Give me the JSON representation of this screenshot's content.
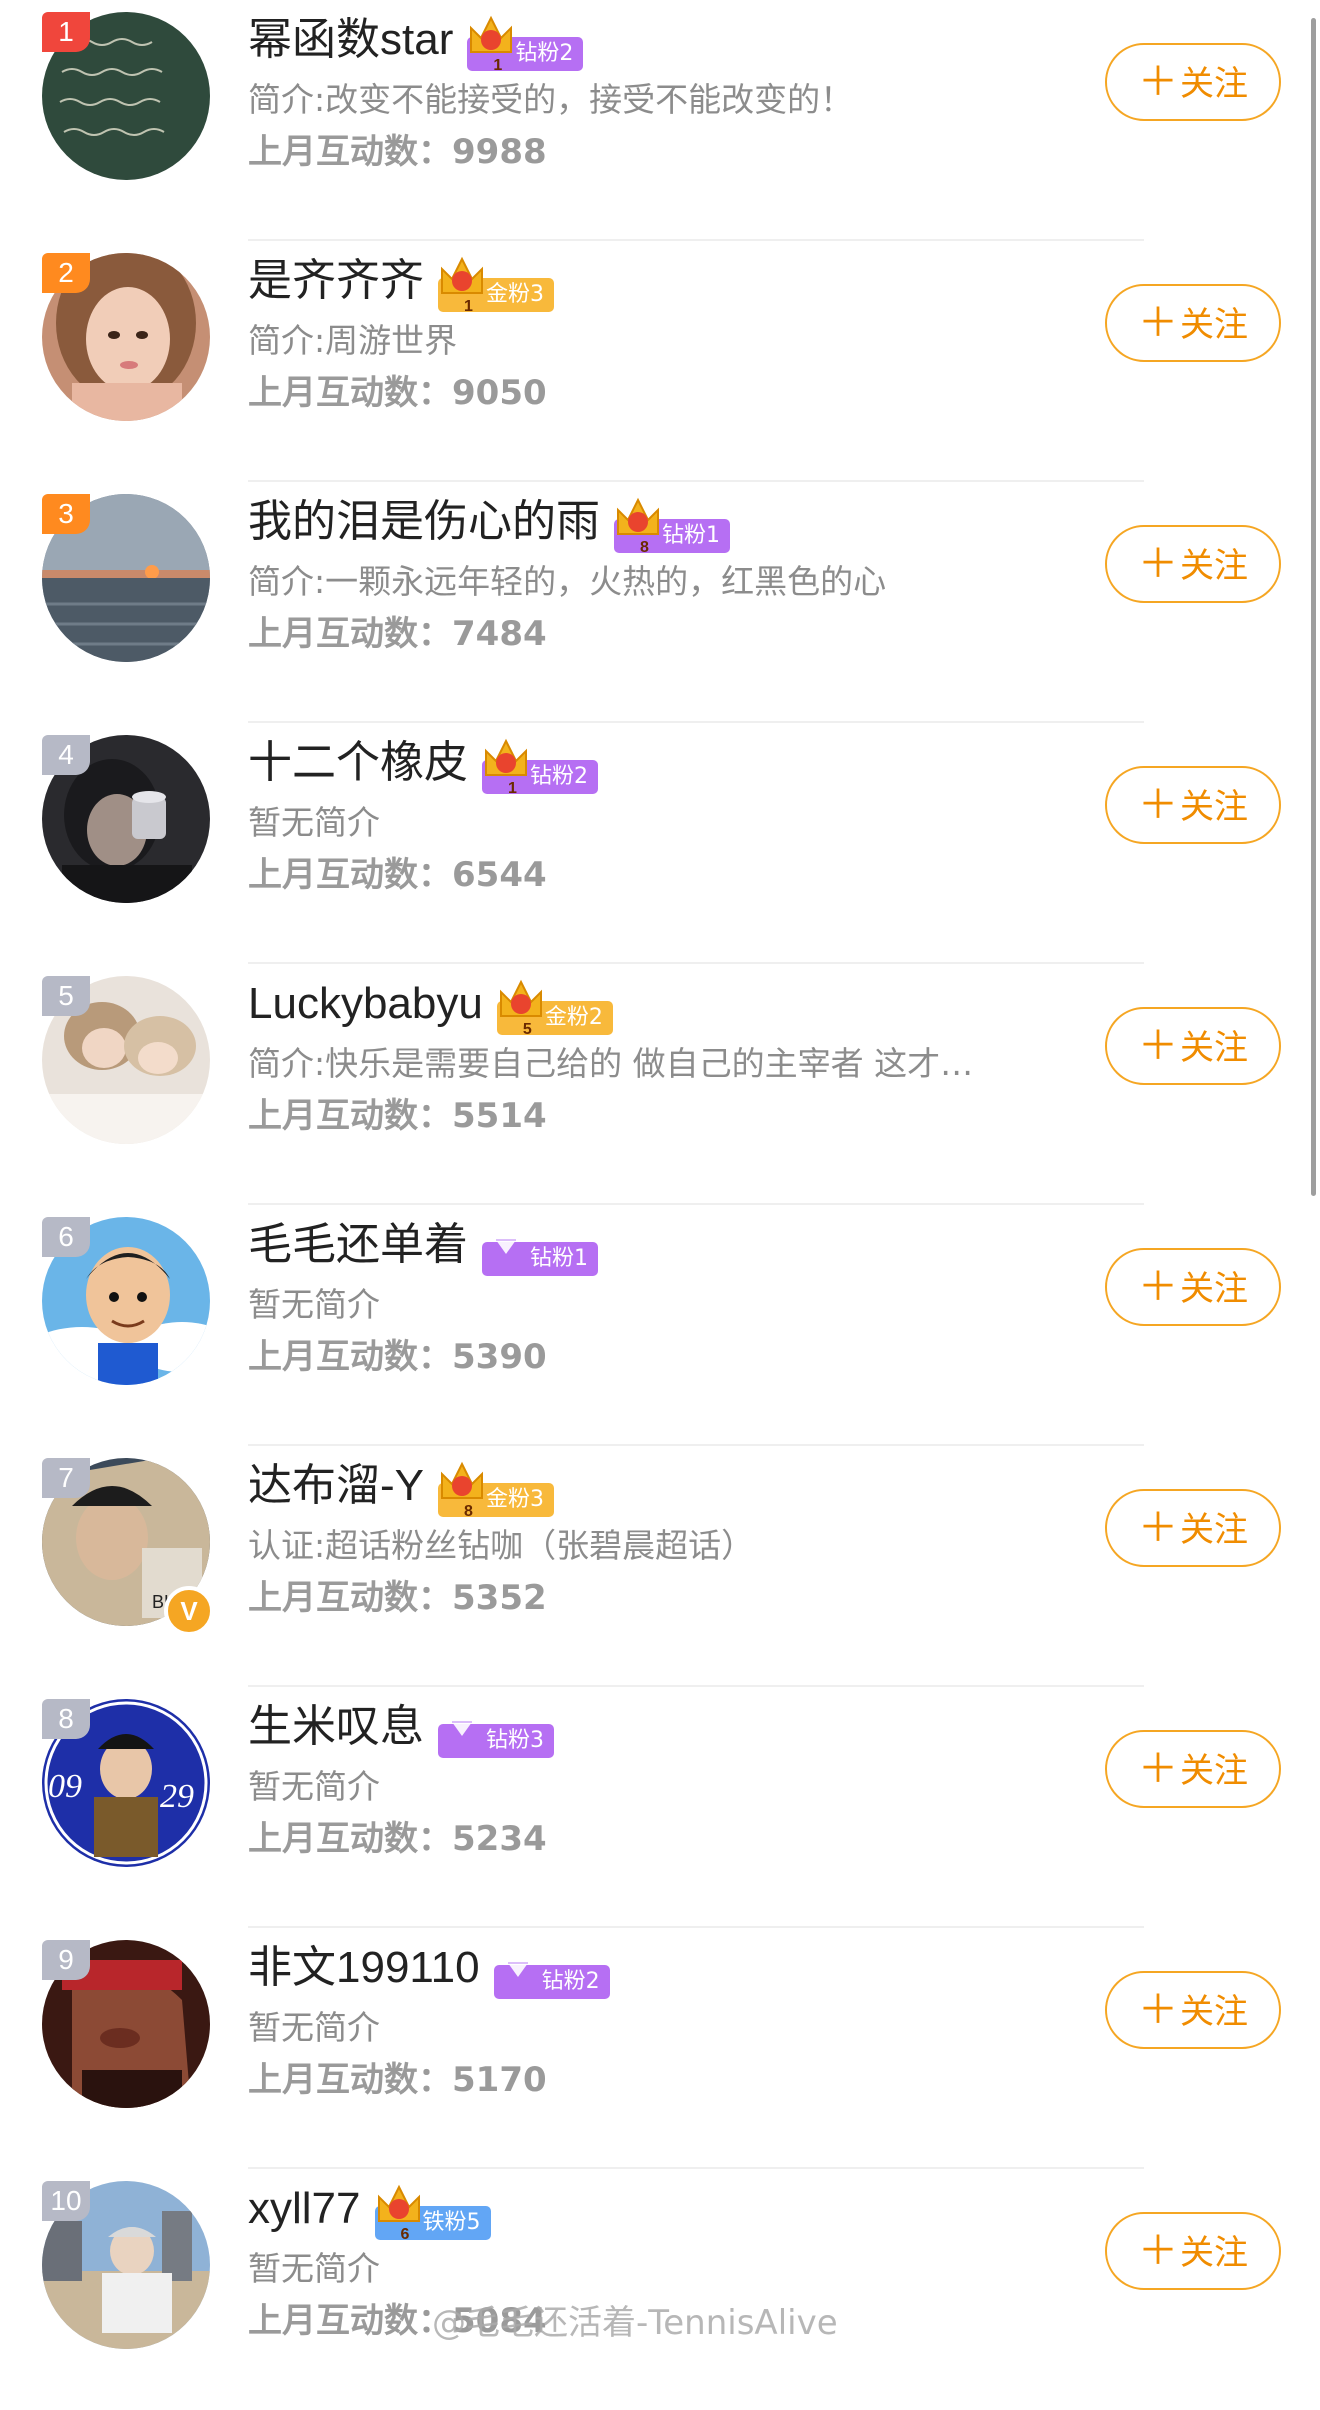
{
  "colors": {
    "follow_accent": "#f5a623",
    "rank_red": "#f0463c",
    "rank_orange": "#ff8a1f",
    "rank_gray": "#b6b9c6",
    "diamond_purple": "#b66ff3",
    "gold_yellow": "#f8b93b",
    "iron_blue": "#62a6f5"
  },
  "follow_label": "关注",
  "users": [
    {
      "rank": "1",
      "name": "幂函数star",
      "badge": {
        "label": "钻粉2",
        "type": "diamond",
        "crown": true,
        "level": "1"
      },
      "bio": "简介:改变不能接受的，接受不能改变的！",
      "stat": "上月互动数：9988",
      "avatar": "chalkboard",
      "verified": false
    },
    {
      "rank": "2",
      "name": "是齐齐齐",
      "badge": {
        "label": "金粉3",
        "type": "gold",
        "crown": true,
        "level": "1"
      },
      "bio": "简介:周游世界",
      "stat": "上月互动数：9050",
      "avatar": "girl-portrait",
      "verified": false
    },
    {
      "rank": "3",
      "name": "我的泪是伤心的雨",
      "badge": {
        "label": "钻粉1",
        "type": "diamond",
        "crown": true,
        "level": "8"
      },
      "bio": "简介:一颗永远年轻的，火热的，红黑色的心",
      "stat": "上月互动数：7484",
      "avatar": "sea-sunset",
      "verified": false
    },
    {
      "rank": "4",
      "name": "十二个橡皮",
      "badge": {
        "label": "钻粉2",
        "type": "diamond",
        "crown": true,
        "level": "1"
      },
      "bio": "暂无简介",
      "stat": "上月互动数：6544",
      "avatar": "dark-portrait",
      "verified": false
    },
    {
      "rank": "5",
      "name": "Luckybabyu",
      "badge": {
        "label": "金粉2",
        "type": "gold",
        "crown": true,
        "level": "5"
      },
      "bio": "简介:快乐是需要自己给的 做自己的主宰者 这才…",
      "stat": "上月互动数：5514",
      "avatar": "pillow-photo",
      "verified": false
    },
    {
      "rank": "6",
      "name": "毛毛还单着",
      "badge": {
        "label": "钻粉1",
        "type": "diamond",
        "crown": false,
        "level": ""
      },
      "bio": "暂无简介",
      "stat": "上月互动数：5390",
      "avatar": "cartoon-boy",
      "verified": false
    },
    {
      "rank": "7",
      "name": "达布溜-Y",
      "badge": {
        "label": "金粉3",
        "type": "gold",
        "crown": true,
        "level": "8"
      },
      "bio": "认证:超话粉丝钻咖（张碧晨超话）",
      "stat": "上月互动数：5352",
      "avatar": "hat-portrait",
      "verified": true
    },
    {
      "rank": "8",
      "name": "生米叹息",
      "badge": {
        "label": "钻粉3",
        "type": "diamond",
        "crown": false,
        "level": ""
      },
      "bio": "暂无简介",
      "stat": "上月互动数：5234",
      "avatar": "blue-poster",
      "verified": false
    },
    {
      "rank": "9",
      "name": "非文199110",
      "badge": {
        "label": "钻粉2",
        "type": "diamond",
        "crown": false,
        "level": ""
      },
      "bio": "暂无简介",
      "stat": "上月互动数：5170",
      "avatar": "profile-face",
      "verified": false
    },
    {
      "rank": "10",
      "name": "xyll77",
      "badge": {
        "label": "铁粉5",
        "type": "iron",
        "crown": true,
        "level": "6"
      },
      "bio": "暂无简介",
      "stat": "上月互动数：5084",
      "avatar": "beach-photo",
      "verified": false
    }
  ],
  "watermark": "@毛毛还活着-TennisAlive"
}
